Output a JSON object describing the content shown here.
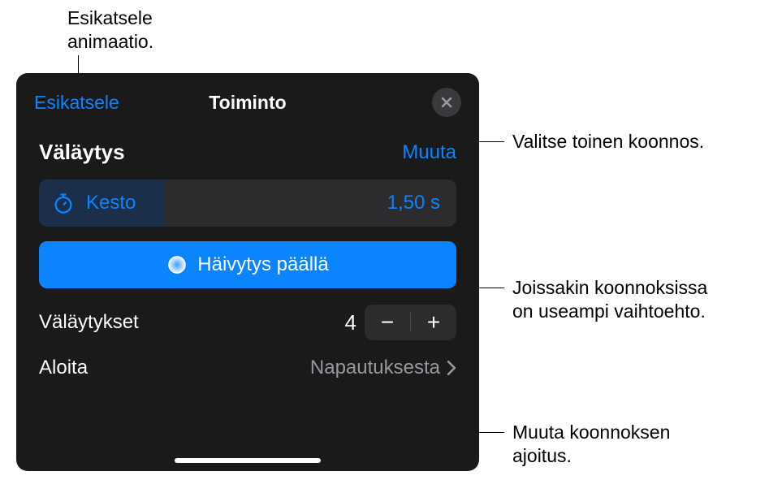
{
  "callouts": {
    "preview": "Esikatsele\nanimaatio.",
    "change": "Valitse toinen koonnos.",
    "fade": "Joissakin koonnoksissa\non useampi vaihtoehto.",
    "start": "Muuta koonnoksen\najoitus."
  },
  "panel": {
    "preview_label": "Esikatsele",
    "title": "Toiminto",
    "effect_name": "Väläytys",
    "change_label": "Muuta",
    "duration": {
      "label": "Kesto",
      "value": "1,50  s"
    },
    "fade_label": "Häivytys päällä",
    "flashes": {
      "label": "Väläytykset",
      "count": "4"
    },
    "start": {
      "label": "Aloita",
      "value": "Napautuksesta"
    }
  }
}
